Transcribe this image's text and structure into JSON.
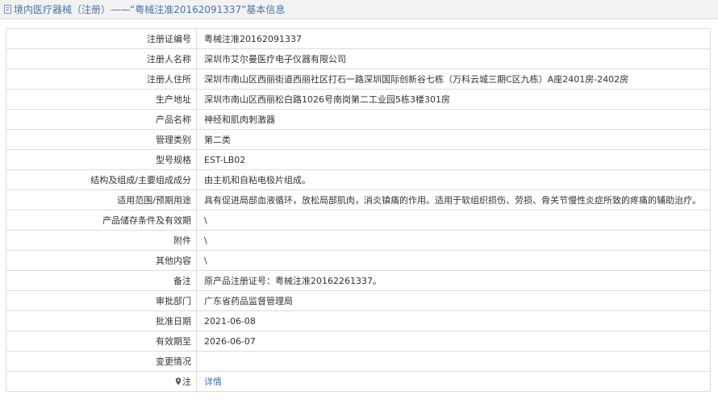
{
  "header": {
    "title": "境内医疗器械（注册）——“粤械注准20162091337”基本信息",
    "icon": "document-icon"
  },
  "rows": [
    {
      "label": "注册证编号",
      "value": "粤械注准20162091337"
    },
    {
      "label": "注册人名称",
      "value": "深圳市艾尔曼医疗电子仪器有限公司"
    },
    {
      "label": "注册人住所",
      "value": "深圳市南山区西丽街道西丽社区打石一路深圳国际创新谷七栋（万科云城三期C区九栋）A座2401房-2402房"
    },
    {
      "label": "生产地址",
      "value": "深圳市南山区西丽松白路1026号南岗第二工业园5栋3楼301房"
    },
    {
      "label": "产品名称",
      "value": "神经和肌肉刺激器"
    },
    {
      "label": "管理类别",
      "value": "第二类"
    },
    {
      "label": "型号规格",
      "value": "EST-LB02"
    },
    {
      "label": "结构及组成/主要组成成分",
      "value": "由主机和自粘电极片组成。"
    },
    {
      "label": "适用范围/预期用途",
      "value": "具有促进局部血液循环，放松局部肌肉，消炎镇痛的作用。适用于软组织损伤、劳损、骨关节慢性炎症所致的疼痛的辅助治疗。"
    },
    {
      "label": "产品储存条件及有效期",
      "value": "\\"
    },
    {
      "label": "附件",
      "value": "\\"
    },
    {
      "label": "其他内容",
      "value": "\\"
    },
    {
      "label": "备注",
      "value": "原产品注册证号：粤械注准20162261337。"
    },
    {
      "label": "审批部门",
      "value": "广东省药品监督管理局"
    },
    {
      "label": "批准日期",
      "value": "2021-06-08"
    },
    {
      "label": "有效期至",
      "value": "2026-06-07"
    },
    {
      "label": "变更情况",
      "value": ""
    }
  ],
  "note_row": {
    "label": "注",
    "icon": "map-pin-icon",
    "link_text": "详情"
  },
  "colors": {
    "title_text": "#4a74a8",
    "link": "#3a6db5",
    "border": "#dcdcdc",
    "title_bg": "#f2f2f2"
  }
}
